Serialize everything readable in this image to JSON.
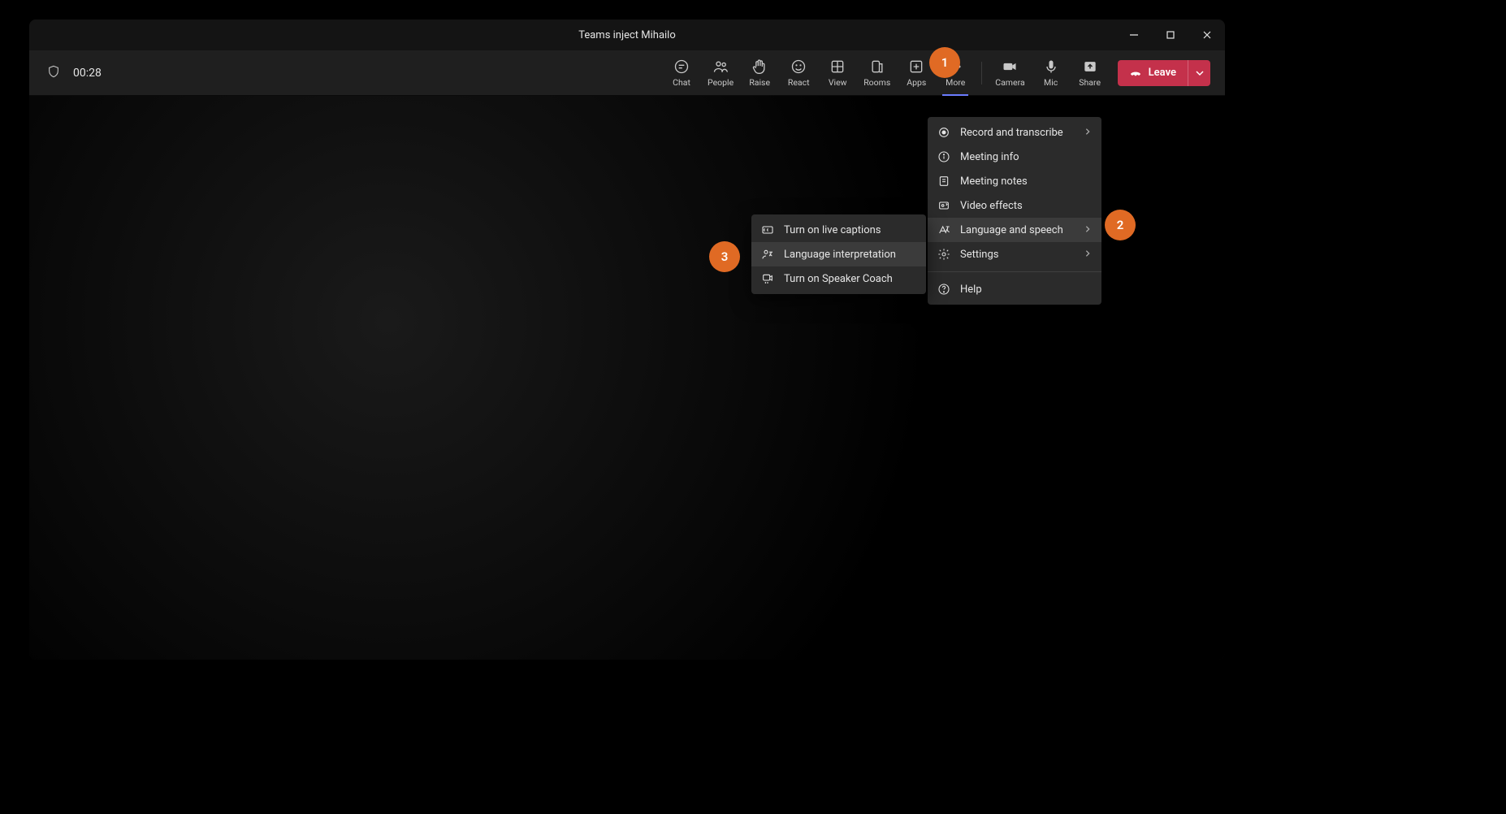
{
  "window": {
    "title": "Teams inject Mihailo"
  },
  "toolbar": {
    "timer": "00:28",
    "items": [
      {
        "id": "chat",
        "label": "Chat"
      },
      {
        "id": "people",
        "label": "People"
      },
      {
        "id": "raise",
        "label": "Raise"
      },
      {
        "id": "react",
        "label": "React"
      },
      {
        "id": "view",
        "label": "View"
      },
      {
        "id": "rooms",
        "label": "Rooms"
      },
      {
        "id": "apps",
        "label": "Apps"
      },
      {
        "id": "more",
        "label": "More"
      }
    ],
    "media": [
      {
        "id": "camera",
        "label": "Camera"
      },
      {
        "id": "mic",
        "label": "Mic"
      },
      {
        "id": "share",
        "label": "Share"
      }
    ],
    "leave": "Leave"
  },
  "more_menu": {
    "items": [
      {
        "id": "record",
        "label": "Record and transcribe",
        "submenu": true
      },
      {
        "id": "info",
        "label": "Meeting info"
      },
      {
        "id": "notes",
        "label": "Meeting notes"
      },
      {
        "id": "effects",
        "label": "Video effects"
      },
      {
        "id": "lang",
        "label": "Language and speech",
        "submenu": true,
        "hover": true
      },
      {
        "id": "settings",
        "label": "Settings",
        "submenu": true
      }
    ],
    "help": "Help"
  },
  "sub_menu": {
    "items": [
      {
        "id": "captions",
        "label": "Turn on live captions"
      },
      {
        "id": "interpret",
        "label": "Language interpretation",
        "hover": true
      },
      {
        "id": "coach",
        "label": "Turn on Speaker Coach"
      }
    ]
  },
  "callouts": {
    "c1": "1",
    "c2": "2",
    "c3": "3"
  }
}
